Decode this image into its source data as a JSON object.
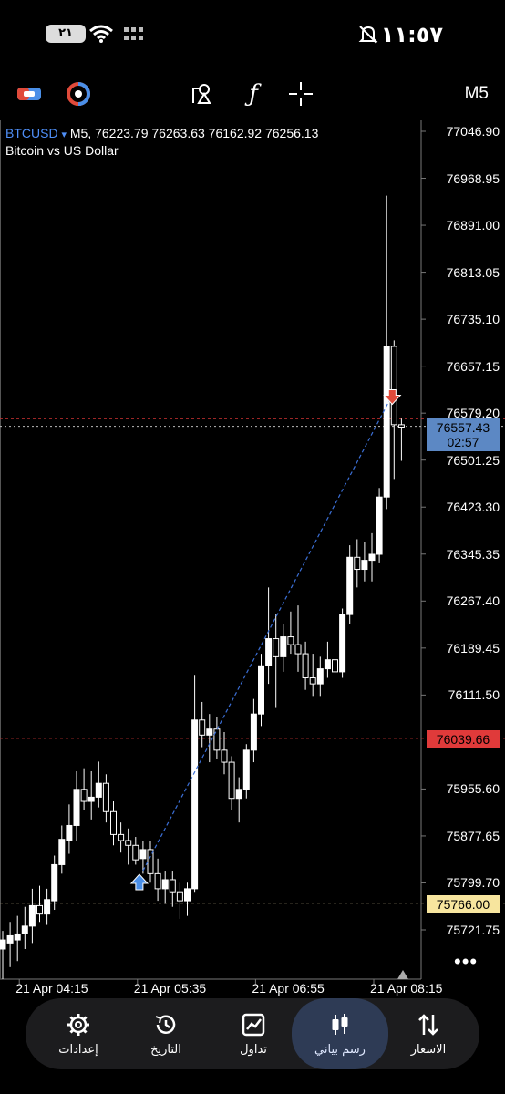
{
  "status_bar": {
    "time": "١١:٥٧",
    "battery": "٢١"
  },
  "toolbar": {
    "timeframe": "M5"
  },
  "chart_header": {
    "symbol": "BTCUSD",
    "dropdown_marker": "▾",
    "timeframe": "M5",
    "ohlc": "76223.79 76263.63 76162.92 76256.13",
    "description": "Bitcoin vs US Dollar"
  },
  "price_tags": {
    "current_price": "76557.43",
    "countdown": "02:57",
    "red_level": "76039.66",
    "yellow_level": "75766.00"
  },
  "more_label": "•••",
  "colors": {
    "background": "#000000",
    "candle_up": "#ffffff",
    "trade_line": "#3b6fd6",
    "red_level": "#d03232",
    "buy_arrow": "#4a8fe8",
    "sell_arrow": "#e04a3a",
    "current_tag": "#5c88c4",
    "yellow_tag": "#f7e59e",
    "nav_bg": "#1c1c1e",
    "nav_active": "#2e3b55"
  },
  "chart_data": {
    "type": "candlestick",
    "title": "",
    "xlabel": "",
    "ylabel": "",
    "y_ticks": [
      "77046.90",
      "76968.95",
      "76891.00",
      "76813.05",
      "76735.10",
      "76657.15",
      "76579.20",
      "76501.25",
      "76423.30",
      "76345.35",
      "76267.40",
      "76189.45",
      "76111.50",
      "76039.66",
      "75955.60",
      "75877.65",
      "75799.70",
      "75766.00",
      "75721.75"
    ],
    "y_tick_values": [
      77046.9,
      76968.95,
      76891.0,
      76813.05,
      76735.1,
      76657.15,
      76579.2,
      76501.25,
      76423.3,
      76345.35,
      76267.4,
      76189.45,
      76111.5,
      76039.66,
      75955.6,
      75877.65,
      75799.7,
      75766.0,
      75721.75
    ],
    "ylim": [
      75700,
      77060
    ],
    "x_ticks": [
      "21 Apr 04:15",
      "21 Apr 05:35",
      "21 Apr 06:55",
      "21 Apr 08:15"
    ],
    "x_tick_candle_index": [
      2,
      18,
      34,
      50
    ],
    "grid": false,
    "levels": [
      {
        "name": "current",
        "value": 76557.43
      },
      {
        "name": "trade-open",
        "value": 76570.0
      },
      {
        "name": "red-level",
        "value": 76039.66
      },
      {
        "name": "yellow-level",
        "value": 75766.0
      }
    ],
    "trade": {
      "buy_index": 19,
      "buy_price": 75820,
      "sell_index": 53,
      "sell_price": 76615
    },
    "candles": [
      {
        "o": 75690,
        "h": 75720,
        "l": 75640,
        "c": 75705
      },
      {
        "o": 75700,
        "h": 75735,
        "l": 75660,
        "c": 75712
      },
      {
        "o": 75705,
        "h": 75745,
        "l": 75670,
        "c": 75715
      },
      {
        "o": 75715,
        "h": 75760,
        "l": 75690,
        "c": 75728
      },
      {
        "o": 75728,
        "h": 75790,
        "l": 75700,
        "c": 75762
      },
      {
        "o": 75762,
        "h": 75795,
        "l": 75735,
        "c": 75748
      },
      {
        "o": 75748,
        "h": 75790,
        "l": 75730,
        "c": 75772
      },
      {
        "o": 75770,
        "h": 75845,
        "l": 75755,
        "c": 75830
      },
      {
        "o": 75830,
        "h": 75895,
        "l": 75815,
        "c": 75872
      },
      {
        "o": 75870,
        "h": 75930,
        "l": 75848,
        "c": 75895
      },
      {
        "o": 75895,
        "h": 75985,
        "l": 75870,
        "c": 75955
      },
      {
        "o": 75955,
        "h": 75990,
        "l": 75920,
        "c": 75935
      },
      {
        "o": 75935,
        "h": 75985,
        "l": 75905,
        "c": 75942
      },
      {
        "o": 75942,
        "h": 76001,
        "l": 75925,
        "c": 75965
      },
      {
        "o": 75965,
        "h": 75980,
        "l": 75900,
        "c": 75918
      },
      {
        "o": 75918,
        "h": 75935,
        "l": 75862,
        "c": 75880
      },
      {
        "o": 75880,
        "h": 75900,
        "l": 75850,
        "c": 75870
      },
      {
        "o": 75870,
        "h": 75890,
        "l": 75830,
        "c": 75862
      },
      {
        "o": 75862,
        "h": 75876,
        "l": 75830,
        "c": 75838
      },
      {
        "o": 75840,
        "h": 75870,
        "l": 75815,
        "c": 75855
      },
      {
        "o": 75855,
        "h": 75870,
        "l": 75800,
        "c": 75815
      },
      {
        "o": 75815,
        "h": 75840,
        "l": 75770,
        "c": 75790
      },
      {
        "o": 75790,
        "h": 75820,
        "l": 75765,
        "c": 75805
      },
      {
        "o": 75805,
        "h": 75820,
        "l": 75760,
        "c": 75785
      },
      {
        "o": 75785,
        "h": 75800,
        "l": 75740,
        "c": 75770
      },
      {
        "o": 75770,
        "h": 75800,
        "l": 75745,
        "c": 75790
      },
      {
        "o": 75790,
        "h": 76145,
        "l": 75785,
        "c": 76070
      },
      {
        "o": 76070,
        "h": 76100,
        "l": 76025,
        "c": 76045
      },
      {
        "o": 76045,
        "h": 76080,
        "l": 76000,
        "c": 76055
      },
      {
        "o": 76055,
        "h": 76075,
        "l": 76005,
        "c": 76020
      },
      {
        "o": 76020,
        "h": 76050,
        "l": 75980,
        "c": 76000
      },
      {
        "o": 76000,
        "h": 76010,
        "l": 75920,
        "c": 75940
      },
      {
        "o": 75940,
        "h": 75975,
        "l": 75900,
        "c": 75955
      },
      {
        "o": 75955,
        "h": 76030,
        "l": 75940,
        "c": 76020
      },
      {
        "o": 76020,
        "h": 76105,
        "l": 76000,
        "c": 76080
      },
      {
        "o": 76080,
        "h": 76180,
        "l": 76060,
        "c": 76160
      },
      {
        "o": 76160,
        "h": 76290,
        "l": 76130,
        "c": 76205
      },
      {
        "o": 76205,
        "h": 76245,
        "l": 76090,
        "c": 76175
      },
      {
        "o": 76175,
        "h": 76230,
        "l": 76150,
        "c": 76208
      },
      {
        "o": 76208,
        "h": 76250,
        "l": 76180,
        "c": 76195
      },
      {
        "o": 76195,
        "h": 76260,
        "l": 76150,
        "c": 76180
      },
      {
        "o": 76180,
        "h": 76200,
        "l": 76120,
        "c": 76140
      },
      {
        "o": 76140,
        "h": 76180,
        "l": 76110,
        "c": 76130
      },
      {
        "o": 76130,
        "h": 76175,
        "l": 76110,
        "c": 76155
      },
      {
        "o": 76155,
        "h": 76200,
        "l": 76140,
        "c": 76170
      },
      {
        "o": 76170,
        "h": 76185,
        "l": 76135,
        "c": 76150
      },
      {
        "o": 76150,
        "h": 76255,
        "l": 76140,
        "c": 76245
      },
      {
        "o": 76245,
        "h": 76360,
        "l": 76230,
        "c": 76340
      },
      {
        "o": 76340,
        "h": 76370,
        "l": 76290,
        "c": 76320
      },
      {
        "o": 76320,
        "h": 76365,
        "l": 76300,
        "c": 76335
      },
      {
        "o": 76335,
        "h": 76380,
        "l": 76300,
        "c": 76345
      },
      {
        "o": 76345,
        "h": 76455,
        "l": 76330,
        "c": 76440
      },
      {
        "o": 76440,
        "h": 76940,
        "l": 76420,
        "c": 76690
      },
      {
        "o": 76690,
        "h": 76700,
        "l": 76470,
        "c": 76560
      },
      {
        "o": 76560,
        "h": 76570,
        "l": 76500,
        "c": 76556
      }
    ]
  },
  "bottom_nav": {
    "items": [
      {
        "label": "إعدادات"
      },
      {
        "label": "التاريخ"
      },
      {
        "label": "تداول"
      },
      {
        "label": "رسم بياني"
      },
      {
        "label": "الاسعار"
      }
    ]
  }
}
